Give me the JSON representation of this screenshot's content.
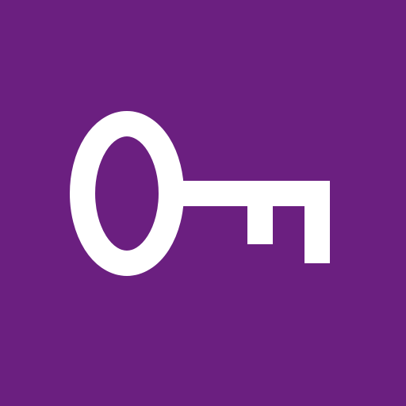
{
  "app_icon": {
    "icon": "key-icon",
    "background_color": "#6B1F80",
    "foreground_color": "#FFFFFF"
  }
}
